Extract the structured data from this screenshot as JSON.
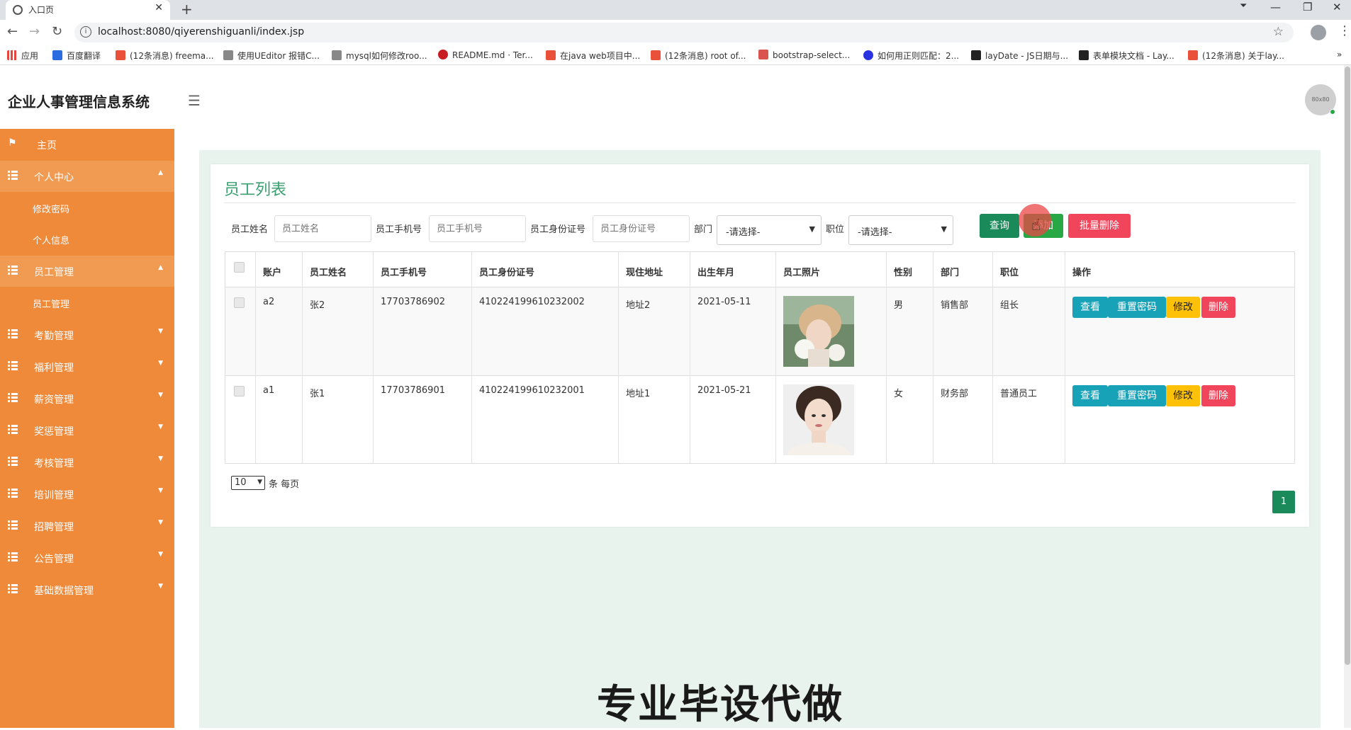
{
  "browser": {
    "tab_title": "入口页",
    "url": "localhost:8080/qiyerenshiguanli/index.jsp",
    "bookmarks": [
      "应用",
      "百度翻译",
      "(12条消息) freema...",
      "使用UEditor 报错C...",
      "mysql如何修改roo...",
      "README.md · Ter...",
      "在java web项目中...",
      "(12条消息) root of...",
      "bootstrap-select...",
      "如何用正则匹配：2...",
      "layDate - JS日期与...",
      "表单模块文档 - Lay...",
      "(12条消息) 关于lay..."
    ]
  },
  "header": {
    "title": "企业人事管理信息系统",
    "avatar_text": "80x80"
  },
  "sidebar": {
    "items": [
      {
        "label": "主页"
      },
      {
        "label": "个人中心",
        "children": [
          "修改密码",
          "个人信息"
        ]
      },
      {
        "label": "员工管理",
        "children": [
          "员工管理"
        ]
      },
      {
        "label": "考勤管理"
      },
      {
        "label": "福利管理"
      },
      {
        "label": "薪资管理"
      },
      {
        "label": "奖惩管理"
      },
      {
        "label": "考核管理"
      },
      {
        "label": "培训管理"
      },
      {
        "label": "招聘管理"
      },
      {
        "label": "公告管理"
      },
      {
        "label": "基础数据管理"
      }
    ]
  },
  "main": {
    "title": "员工列表",
    "filters": {
      "name_label": "员工姓名",
      "name_placeholder": "员工姓名",
      "phone_label": "员工手机号",
      "phone_placeholder": "员工手机号",
      "idcard_label": "员工身份证号",
      "idcard_placeholder": "员工身份证号",
      "dept_label": "部门",
      "dept_value": "-请选择-",
      "position_label": "职位",
      "position_value": "-请选择-"
    },
    "buttons": {
      "search": "查询",
      "add": "添加",
      "batch_delete": "批量删除"
    },
    "table": {
      "headers": [
        "账户",
        "员工姓名",
        "员工手机号",
        "员工身份证号",
        "现住地址",
        "出生年月",
        "员工照片",
        "性别",
        "部门",
        "职位",
        "操作"
      ],
      "rows": [
        {
          "account": "a2",
          "name": "张2",
          "phone": "17703786902",
          "idcard": "410224199610232002",
          "address": "地址2",
          "birth": "2021-05-11",
          "gender": "男",
          "dept": "销售部",
          "position": "组长"
        },
        {
          "account": "a1",
          "name": "张1",
          "phone": "17703786901",
          "idcard": "410224199610232001",
          "address": "地址1",
          "birth": "2021-05-21",
          "gender": "女",
          "dept": "财务部",
          "position": "普通员工"
        }
      ],
      "actions": {
        "view": "查看",
        "reset": "重置密码",
        "edit": "修改",
        "delete": "删除"
      }
    },
    "pagination": {
      "page_size": "10",
      "page_size_suffix": "条 每页",
      "current_page": "1"
    }
  },
  "watermark": "专业毕设代做",
  "colors": {
    "sidebar": "#ef8a3a",
    "accent_green": "#1a8a5a",
    "view_btn": "#17a2b8",
    "edit_btn": "#ffc107",
    "delete_btn": "#f0455a",
    "add_btn": "#28a745"
  }
}
